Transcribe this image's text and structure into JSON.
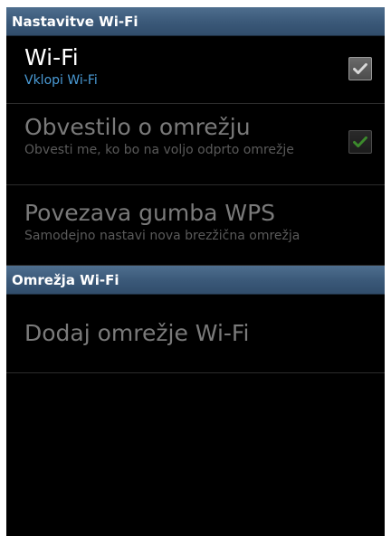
{
  "header_settings": {
    "title": "Nastavitve Wi-Fi"
  },
  "wifi": {
    "title": "Wi-Fi",
    "summary": "Vklopi Wi-Fi",
    "checked": true,
    "enabled": true,
    "check_icon": "check-icon"
  },
  "network_notification": {
    "title": "Obvestilo o omrežju",
    "summary": "Obvesti me, ko bo na voljo odprto omrežje",
    "checked": true,
    "enabled": false,
    "check_icon": "check-icon"
  },
  "wps": {
    "title": "Povezava gumba WPS",
    "summary": "Samodejno nastavi nova brezžična omrežja",
    "enabled": false
  },
  "header_networks": {
    "title": "Omrežja Wi-Fi"
  },
  "add_network": {
    "title": "Dodaj omrežje Wi-Fi",
    "enabled": false
  },
  "colors": {
    "header_background": "#3a5878",
    "summary_accent": "#4a9bd6",
    "check_enabled": "#d8d8d8",
    "check_disabled": "#3c8a2c",
    "disabled_text": "#7a7a7a"
  }
}
